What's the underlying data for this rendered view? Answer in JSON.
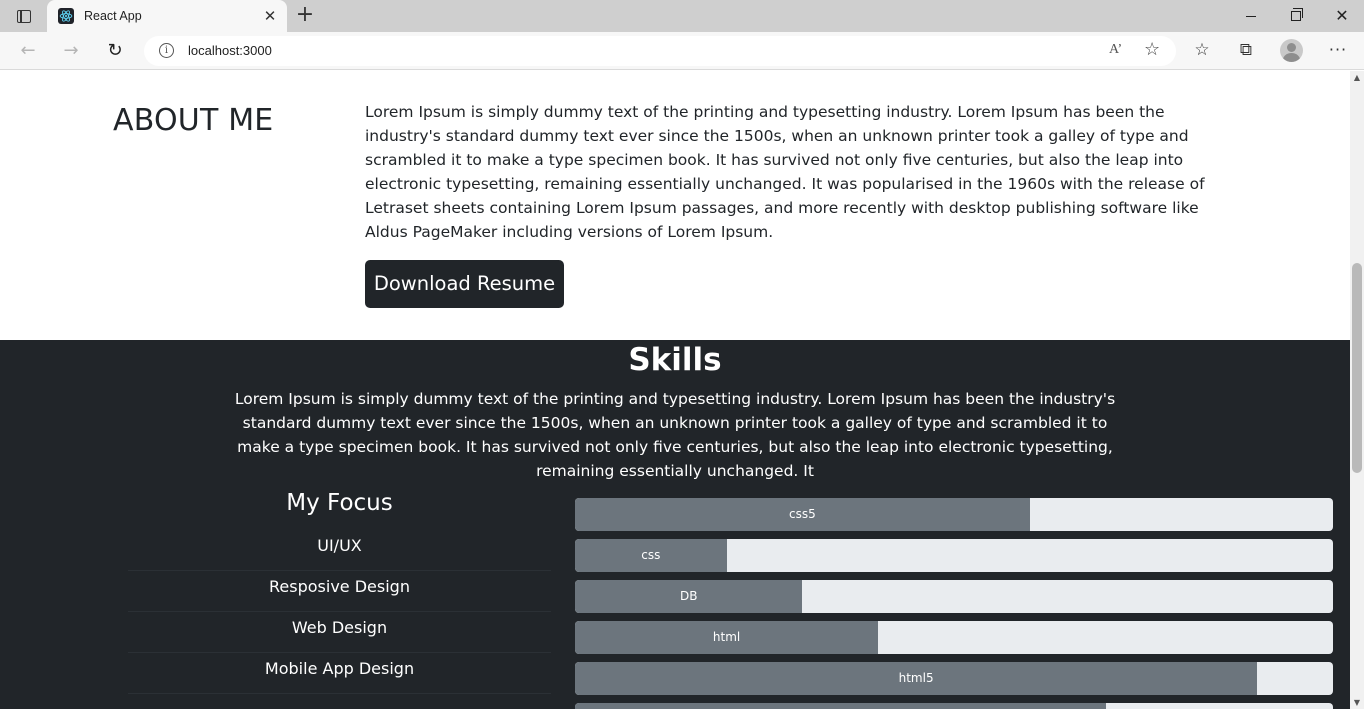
{
  "browser": {
    "tab_title": "React App",
    "url": "localhost:3000",
    "tab_close": "✕",
    "new_tab": "+",
    "read_aloud": "A’"
  },
  "about": {
    "heading": "ABOUT ME",
    "text": "Lorem Ipsum is simply dummy text of the printing and typesetting industry. Lorem Ipsum has been the industry's standard dummy text ever since the 1500s, when an unknown printer took a galley of type and scrambled it to make a type specimen book. It has survived not only five centuries, but also the leap into electronic typesetting, remaining essentially unchanged. It was popularised in the 1960s with the release of Letraset sheets containing Lorem Ipsum passages, and more recently with desktop publishing software like Aldus PageMaker including versions of Lorem Ipsum.",
    "button_label": "Download Resume"
  },
  "skills": {
    "title": "Skills",
    "text": "Lorem Ipsum is simply dummy text of the printing and typesetting industry. Lorem Ipsum has been the industry's standard dummy text ever since the 1500s, when an unknown printer took a galley of type and scrambled it to make a type specimen book. It has survived not only five centuries, but also the leap into electronic typesetting, remaining essentially unchanged. It",
    "focus_title": "My Focus",
    "focus_items": [
      "UI/UX",
      "Resposive Design",
      "Web Design",
      "Mobile App Design"
    ],
    "progress": [
      {
        "label": "css5",
        "value": 60
      },
      {
        "label": "css",
        "value": 20
      },
      {
        "label": "DB",
        "value": 30
      },
      {
        "label": "html",
        "value": 40
      },
      {
        "label": "html5",
        "value": 90
      },
      {
        "label": "",
        "value": 70
      }
    ]
  },
  "colors": {
    "dark": "#212529",
    "bar_fill": "#6c757d",
    "bar_track": "#e9ecef"
  }
}
